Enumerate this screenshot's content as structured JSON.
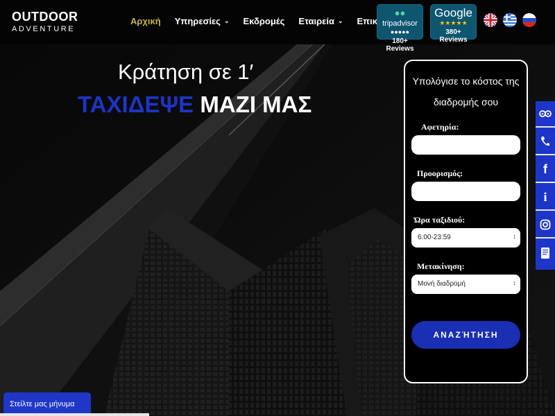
{
  "header": {
    "logo_line1": "OUTDOOR",
    "logo_line2": "ADVENTURE",
    "nav": [
      {
        "label": "Αρχική",
        "active": true,
        "dropdown": false
      },
      {
        "label": "Υπηρεσίες",
        "active": false,
        "dropdown": true
      },
      {
        "label": "Εκδρομές",
        "active": false,
        "dropdown": false
      },
      {
        "label": "Εταιρεία",
        "active": false,
        "dropdown": true
      },
      {
        "label": "Επικοινωνία",
        "active": false,
        "dropdown": false
      }
    ],
    "badges": {
      "tripadvisor": {
        "name": "tripadvisor",
        "reviews": "180+ Reviews"
      },
      "google": {
        "name": "Google",
        "reviews": "380+ Reviews"
      }
    },
    "flags": [
      "uk-flag-icon",
      "greece-flag-icon",
      "russia-flag-icon"
    ]
  },
  "hero": {
    "title": "Κράτηση σε 1′",
    "subtitle_blue": "ΤΑΧΙΔΕΨΕ",
    "subtitle_white": "ΜΑΖΙ ΜΑΣ"
  },
  "form": {
    "title_line1": "Υπολόγισε το κόστος της",
    "title_line2": "διαδρομής σου",
    "departure_label": "Αφετηρία:",
    "destination_label": "Προορισμός:",
    "time_label": "Ώρα ταξιδιού:",
    "time_value": "6:00-23:59",
    "transfer_label": "Μετακίνηση:",
    "transfer_value": "Μονή διαδρομή",
    "search_button": "ΑΝΑΖΉΤΗΣΗ"
  },
  "side_bar": [
    "tripadvisor-icon",
    "phone-icon",
    "facebook-icon",
    "info-icon",
    "instagram-icon",
    "book-icon"
  ],
  "chat": {
    "label": "Στείλτε μας μήνυμα"
  },
  "colors": {
    "accent_blue": "#1d36c8",
    "nav_active": "#c9b83b",
    "badge_bg": "#0e5570"
  }
}
